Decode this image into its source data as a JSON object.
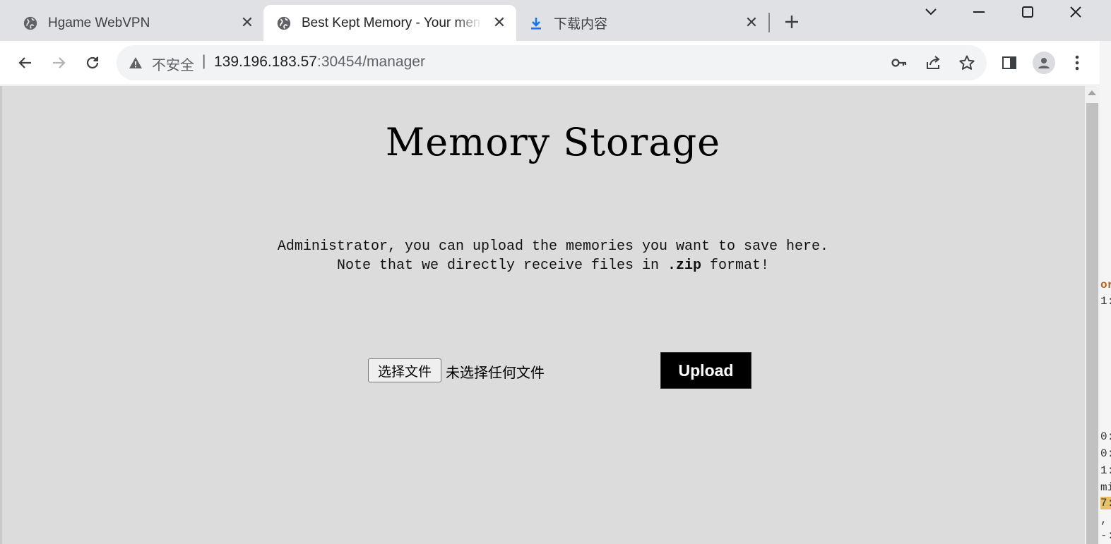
{
  "browser": {
    "tabs": [
      {
        "title": "Hgame WebVPN",
        "icon": "globe-icon",
        "active": false
      },
      {
        "title": "Best Kept Memory - Your memories",
        "icon": "globe-icon",
        "active": true
      },
      {
        "title": "下载内容",
        "icon": "download-icon",
        "active": false
      }
    ],
    "address": {
      "security_label": "不安全",
      "separator": "|",
      "host": "139.196.183.57",
      "rest": ":30454/manager"
    },
    "colors": {
      "tab_strip": "#dfe1e5",
      "omnibox": "#f1f3f4",
      "download_icon": "#1a73e8"
    }
  },
  "page": {
    "title": "Memory Storage",
    "description_line1": "Administrator, you can upload the memories you want to save here.",
    "description_line2_prefix": "Note that we directly receive files in ",
    "description_line2_code": ".zip",
    "description_line2_suffix": " format!",
    "file_button_label": "选择文件",
    "file_status": "未选择任何文件",
    "upload_label": "Upload",
    "background_color": "#dcdcdc"
  },
  "background_window": {
    "fragments": [
      "or",
      "1:",
      "0:",
      "0:",
      "1:",
      "mi",
      "7:",
      ",",
      "-:"
    ]
  }
}
